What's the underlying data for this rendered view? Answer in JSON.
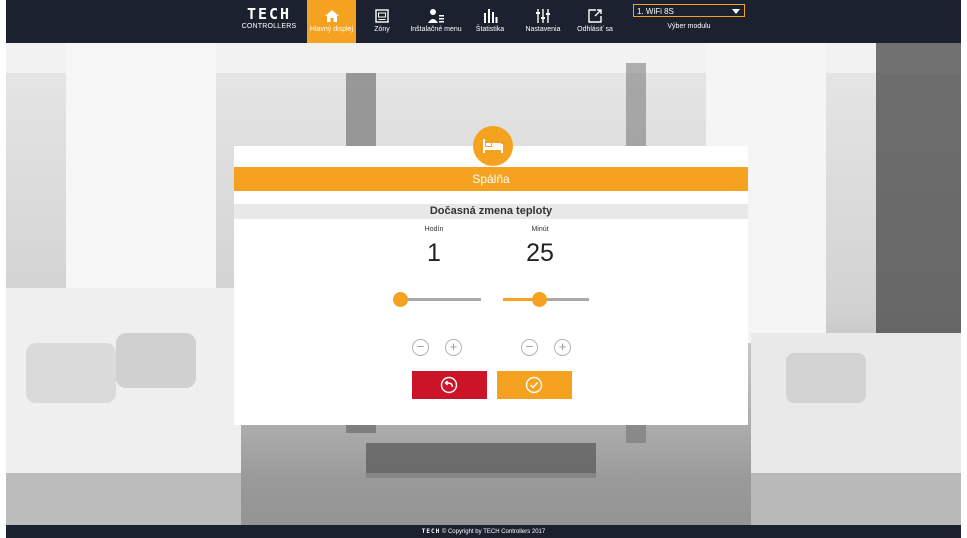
{
  "logo": {
    "brand": "TECH",
    "sub": "CONTROLLERS"
  },
  "nav": [
    {
      "label": "Hlavný displej",
      "icon": "home-icon",
      "active": true
    },
    {
      "label": "Zóny",
      "icon": "zones-icon",
      "active": false
    },
    {
      "label": "Inštalačné menu",
      "icon": "installer-menu-icon",
      "active": false
    },
    {
      "label": "Štatistika",
      "icon": "statistics-icon",
      "active": false
    },
    {
      "label": "Nastavenia",
      "icon": "settings-sliders-icon",
      "active": false
    },
    {
      "label": "Odhlásiť sa",
      "icon": "logout-icon",
      "active": false
    }
  ],
  "module": {
    "selected": "1. WiFi 8S",
    "caption": "Výber modulu"
  },
  "dialog": {
    "zone_name": "Spálňa",
    "zone_icon": "bed-icon",
    "title": "Dočasná zmena teploty",
    "hours": {
      "label": "Hodín",
      "value": "1",
      "slider_fraction": 0.05
    },
    "minutes": {
      "label": "Minút",
      "value": "25",
      "slider_fraction": 0.42
    },
    "back_icon": "back-arrow-icon",
    "confirm_icon": "check-icon"
  },
  "footer": {
    "brand": "TECH",
    "text": "© Copyright by TECH Controllers 2017"
  },
  "colors": {
    "accent": "#f4a21f",
    "danger": "#cc1429",
    "bar": "#1c2130"
  }
}
